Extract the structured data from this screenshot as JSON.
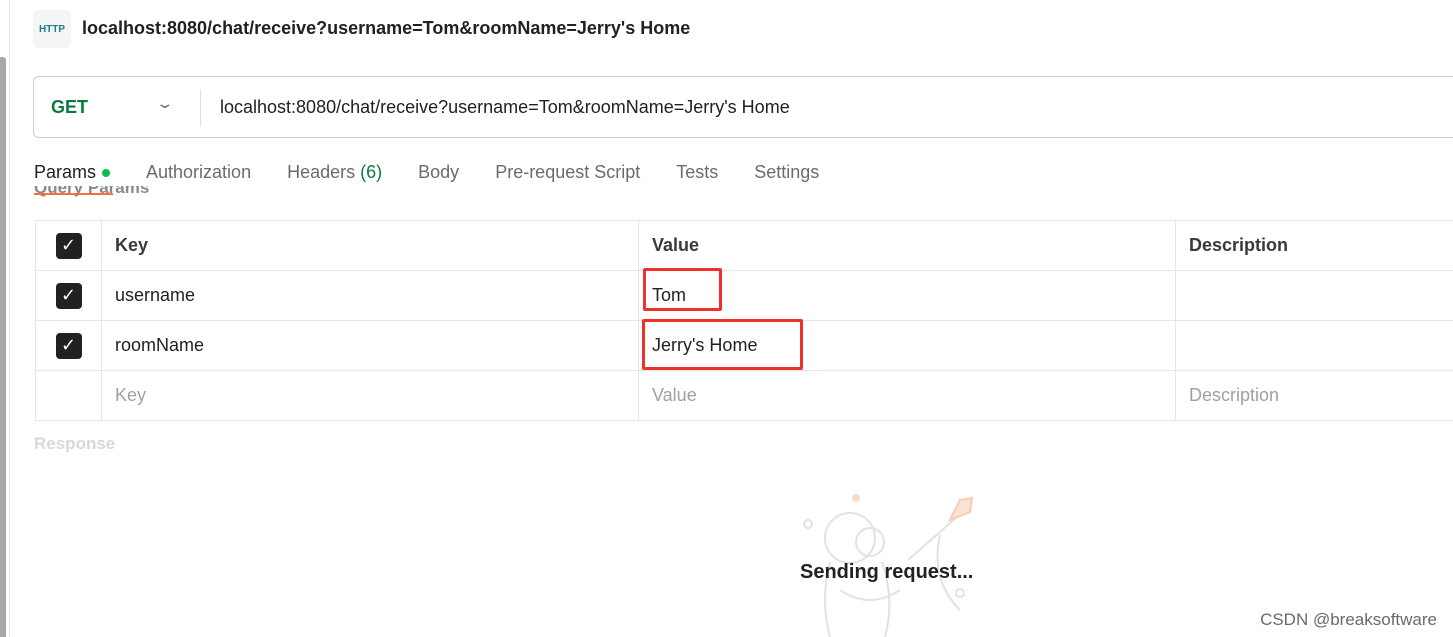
{
  "request": {
    "title": "localhost:8080/chat/receive?username=Tom&roomName=Jerry's Home",
    "icon_label": "HTTP",
    "method": "GET",
    "url": "localhost:8080/chat/receive?username=Tom&roomName=Jerry's Home"
  },
  "tabs": [
    {
      "label": "Params"
    },
    {
      "label": "Authorization"
    },
    {
      "label": "Headers",
      "count": "(6)"
    },
    {
      "label": "Body"
    },
    {
      "label": "Pre-request Script"
    },
    {
      "label": "Tests"
    },
    {
      "label": "Settings"
    }
  ],
  "section_label": "Query Params",
  "params": {
    "headers": {
      "key": "Key",
      "value": "Value",
      "description": "Description"
    },
    "rows": [
      {
        "key": "username",
        "value": "Tom",
        "checked": true
      },
      {
        "key": "roomName",
        "value": "Jerry's Home",
        "checked": true
      }
    ],
    "placeholders": {
      "key": "Key",
      "value": "Value",
      "description": "Description"
    }
  },
  "response": {
    "label": "Response",
    "status": "Sending request..."
  },
  "watermark": "CSDN @breaksoftware",
  "colors": {
    "method": "#0b7a3e",
    "active_tab": "#ff6c37",
    "highlight": "#f0302a"
  }
}
